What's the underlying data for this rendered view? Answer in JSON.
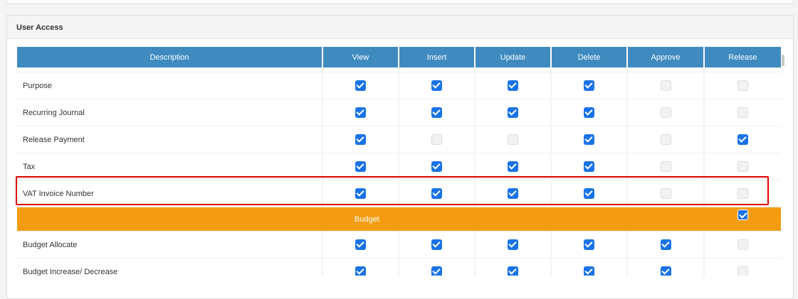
{
  "panel": {
    "title": "User Access"
  },
  "columns": [
    "Description",
    "View",
    "Insert",
    "Update",
    "Delete",
    "Approve",
    "Release"
  ],
  "rows": [
    {
      "label": "Purpose",
      "checks": [
        true,
        true,
        true,
        true,
        false,
        false
      ]
    },
    {
      "label": "Recurring Journal",
      "checks": [
        true,
        true,
        true,
        true,
        false,
        false
      ]
    },
    {
      "label": "Release Payment",
      "checks": [
        true,
        false,
        false,
        true,
        false,
        true
      ]
    },
    {
      "label": "Tax",
      "checks": [
        true,
        true,
        true,
        true,
        false,
        false
      ]
    },
    {
      "label": "VAT Invoice Number",
      "checks": [
        true,
        true,
        true,
        true,
        false,
        false
      ]
    }
  ],
  "group": {
    "label": "Budget",
    "checked": true
  },
  "group_rows": [
    {
      "label": "Budget Allocate",
      "checks": [
        true,
        true,
        true,
        true,
        true,
        false
      ]
    },
    {
      "label": "Budget Increase/ Decrease",
      "checks": [
        true,
        true,
        true,
        true,
        true,
        false
      ]
    }
  ],
  "colors": {
    "header": "#3f8bbf",
    "group": "#f39c12",
    "checkbox_on": "#1a73e8",
    "highlight": "#e00000"
  }
}
